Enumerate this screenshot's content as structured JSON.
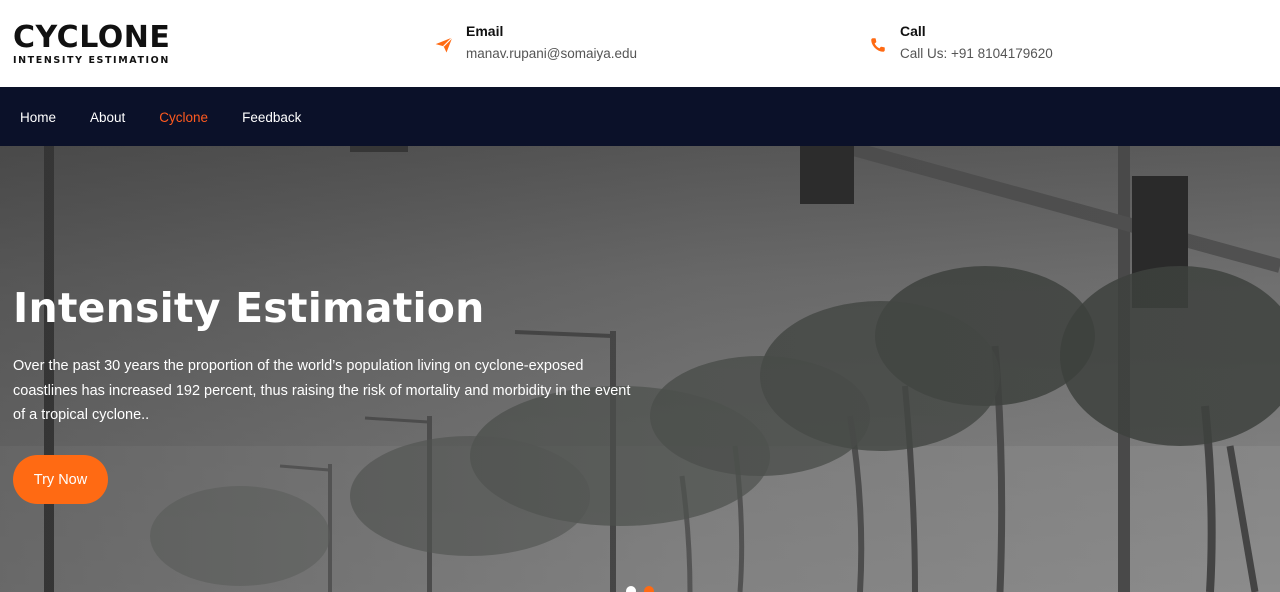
{
  "brand": {
    "title": "CYCLONE",
    "subtitle": "INTENSITY ESTIMATION"
  },
  "contact": {
    "email": {
      "title": "Email",
      "value": "manav.rupani@somaiya.edu",
      "icon": "paper-plane-icon"
    },
    "call": {
      "title": "Call",
      "value": "Call Us: +91 8104179620",
      "icon": "phone-icon"
    }
  },
  "nav": {
    "items": [
      {
        "label": "Home",
        "active": false
      },
      {
        "label": "About",
        "active": false
      },
      {
        "label": "Cyclone",
        "active": true
      },
      {
        "label": "Feedback",
        "active": false
      }
    ]
  },
  "hero": {
    "title": "Intensity Estimation",
    "text": "Over the past 30 years the proportion of the world’s population living on cyclone-exposed coastlines has increased 192 percent, thus raising the risk of mortality and morbidity in the event of a tropical cyclone..",
    "button": "Try Now"
  },
  "colors": {
    "accent": "#ff6a13",
    "nav_bg": "#0b1129",
    "active_link": "#ff5a1f"
  }
}
